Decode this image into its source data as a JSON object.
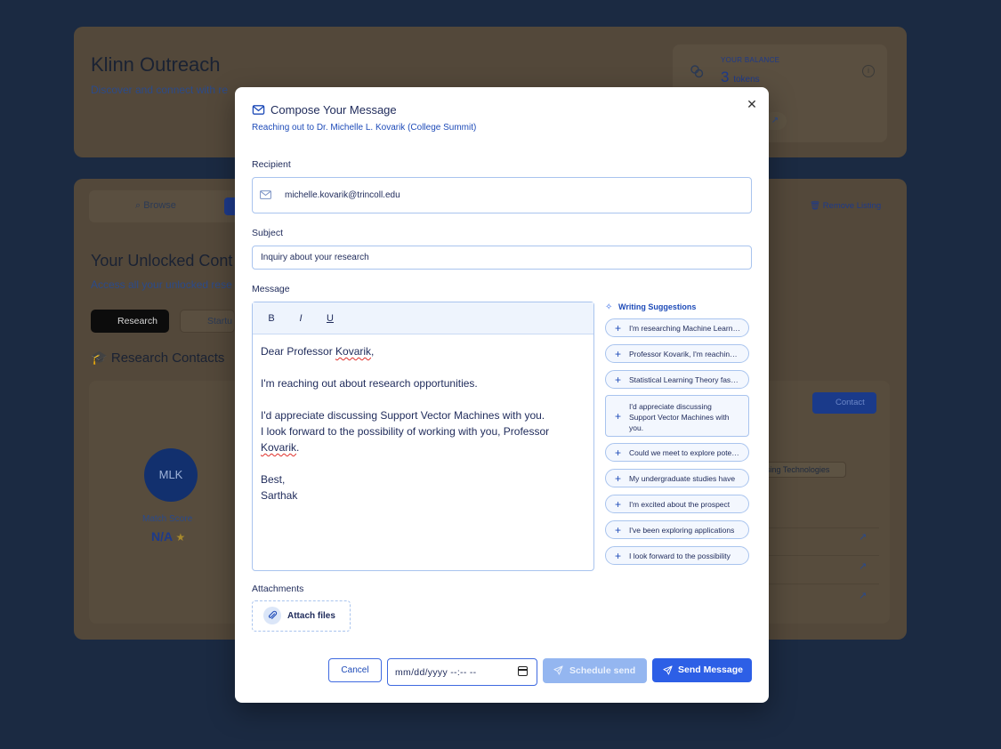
{
  "background": {
    "header": {
      "title": "Klinn Outreach",
      "subtitle": "Discover and connect with re",
      "balance_label": "YOUR BALANCE",
      "balance_value": "3",
      "balance_unit": "tokens"
    },
    "tabs": {
      "browse": "Browse"
    },
    "remove_listing": "Remove Listing",
    "section_title": "Your Unlocked Cont",
    "section_sub": "Access all your unlocked rese",
    "filters": {
      "research": "Research",
      "startup": "Startu"
    },
    "contacts_title": "Research Contacts",
    "card": {
      "initials": "MLK",
      "match_label": "Match Score",
      "match_value": "N/A",
      "contact_button": "Contact",
      "tag": "sing Technologies"
    }
  },
  "modal": {
    "title": "Compose Your Message",
    "subtitle": "Reaching out to Dr. Michelle L. Kovarik (College Summit)",
    "recipient_label": "Recipient",
    "recipient_value": "michelle.kovarik@trincoll.edu",
    "subject_label": "Subject",
    "subject_value": "Inquiry about your research",
    "message_label": "Message",
    "toolbar": {
      "bold": "B",
      "italic": "I",
      "underline": "U"
    },
    "message": {
      "greeting_pre": "Dear Professor ",
      "greeting_name": "Kovarik",
      "greeting_post": ",",
      "line1": "I'm reaching out about research opportunities.",
      "line2": "I'd appreciate discussing Support Vector Machines with you.",
      "line3": "I look forward to the possibility of working with you, Professor",
      "line4_name": "Kovarik",
      "line4_post": ".",
      "signoff": "Best,",
      "signature": "Sarthak"
    },
    "suggestions_title": "Writing Suggestions",
    "suggestions": [
      "I'm researching Machine Learning",
      "Professor Kovarik, I'm reaching out",
      "Statistical Learning Theory fascinates me",
      "I'd appreciate discussing Support Vector Machines with you.",
      "Could we meet to explore potential",
      "My undergraduate studies have",
      "I'm excited about the prospect",
      "I've been exploring applications",
      "I look forward to the possibility"
    ],
    "attachments_label": "Attachments",
    "attach_button": "Attach files",
    "cancel_button": "Cancel",
    "date_placeholder": "mm/dd/yyyy --:-- --",
    "schedule_button": "Schedule send",
    "send_button": "Send Message"
  }
}
